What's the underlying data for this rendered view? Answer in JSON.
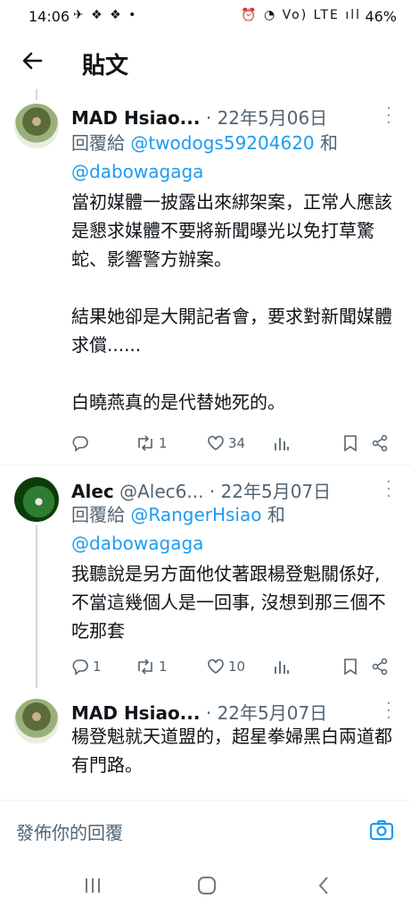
{
  "status_bar": {
    "time": "14:06",
    "left_icons": "✈ ❖ ❖ •",
    "right_icons": "⏰ ◔ Vo) LTE ıll",
    "battery": "46%"
  },
  "header": {
    "title": "貼文"
  },
  "tweets": [
    {
      "name": "MAD Hsiao...",
      "handle": "",
      "date": "22年5月06日",
      "reply_prefix": "回覆給",
      "mention1": "@twodogs59204620",
      "and": "和",
      "mention2": "@dabowagaga",
      "body": "當初媒體一披露出來綁架案，正常人應該是懇求媒體不要將新聞曝光以免打草驚蛇、影響警方辦案。\n\n結果她卻是大開記者會，要求對新聞媒體求償......\n\n白曉燕真的是代替她死的。",
      "replies": "",
      "retweets": "1",
      "likes": "34"
    },
    {
      "name": "Alec",
      "handle": "@Alec6...",
      "date": "22年5月07日",
      "reply_prefix": "回覆給",
      "mention1": "@RangerHsiao",
      "and": "和",
      "mention2": "@dabowagaga",
      "body": "我聽說是另方面他仗著跟楊登魁關係好, 不當這幾個人是一回事, 沒想到那三個不吃那套",
      "replies": "1",
      "retweets": "1",
      "likes": "10"
    },
    {
      "name": "MAD Hsiao...",
      "date": "22年5月07日",
      "body": "楊登魁就天道盟的，超星拳婦黑白兩道都有門路。"
    }
  ],
  "compose": {
    "placeholder": "發佈你的回覆"
  }
}
